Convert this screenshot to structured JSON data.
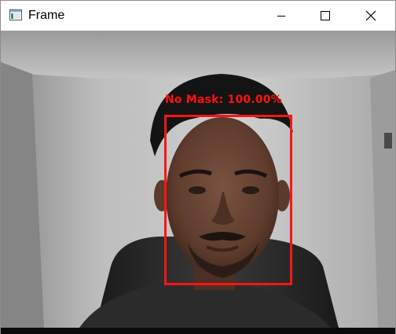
{
  "window": {
    "title": "Frame",
    "icon": "app-window-icon",
    "controls": {
      "minimize": "minimize-icon",
      "maximize": "maximize-icon",
      "close": "close-icon"
    }
  },
  "frame": {
    "description_icon": "webcam-frame",
    "detection": {
      "label": "No Mask: 100.00%",
      "color": "#ff1414"
    }
  }
}
